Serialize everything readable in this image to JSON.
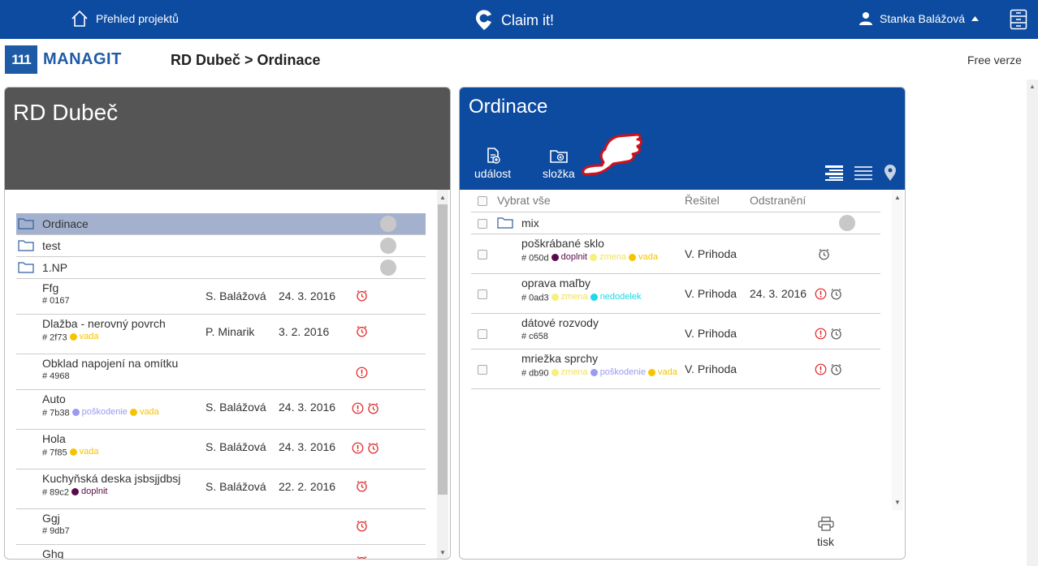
{
  "topbar": {
    "home_label": "Přehled projektů",
    "brand": "Claim it!",
    "user": "Stanka Balážová"
  },
  "header": {
    "logo_box": "111",
    "logo_text": "MANAGIT",
    "breadcrumb": "RD Dubeč > Ordinace",
    "free": "Free verze"
  },
  "left": {
    "title": "RD Dubeč",
    "folders": [
      {
        "name": "Ordinace",
        "selected": true
      },
      {
        "name": "test"
      },
      {
        "name": "1.NP"
      }
    ],
    "items": [
      {
        "title": "Ffg",
        "code": "# 0167",
        "tags": [],
        "person": "S. Balážová",
        "date": "24. 3. 2016",
        "warn": false,
        "clock": true
      },
      {
        "title": "Dlažba - nerovný povrch",
        "code": "# 2f73",
        "tags": [
          {
            "label": "vada",
            "color": "#f5c400"
          }
        ],
        "person": "P. Minarik",
        "date": "3. 2. 2016",
        "warn": false,
        "clock": true
      },
      {
        "title": "Obklad napojení na omítku",
        "code": "# 4968",
        "tags": [],
        "person": "",
        "date": "",
        "warn": true,
        "clock": false
      },
      {
        "title": "Auto",
        "code": "# 7b38",
        "tags": [
          {
            "label": "poškodenie",
            "color": "#9a9af2"
          },
          {
            "label": "vada",
            "color": "#f5c400"
          }
        ],
        "person": "S. Balážová",
        "date": "24. 3. 2016",
        "warn": true,
        "clock": true
      },
      {
        "title": "Hola",
        "code": "# 7f85",
        "tags": [
          {
            "label": "vada",
            "color": "#f5c400"
          }
        ],
        "person": "S. Balážová",
        "date": "24. 3. 2016",
        "warn": true,
        "clock": true
      },
      {
        "title": "Kuchyňská deska jsbsjjdbsj",
        "code": "# 89c2",
        "tags": [
          {
            "label": "doplnit",
            "color": "#5a0a4a"
          }
        ],
        "person": "S. Balážová",
        "date": "22. 2. 2016",
        "warn": false,
        "clock": true
      },
      {
        "title": "Ggj",
        "code": "# 9db7",
        "tags": [],
        "person": "",
        "date": "",
        "warn": false,
        "clock": true
      },
      {
        "title": "Ghg",
        "code": "",
        "tags": [],
        "person": "",
        "date": "",
        "warn": false,
        "clock": true
      }
    ]
  },
  "right": {
    "title": "Ordinace",
    "tool_event": "událost",
    "tool_folder": "složka",
    "col_select": "Vybrat vše",
    "col_solver": "Řešitel",
    "col_removal": "Odstranění",
    "folders": [
      {
        "name": "mix"
      }
    ],
    "items": [
      {
        "title": "poškrábané sklo",
        "code": "# 050d",
        "tags": [
          {
            "label": "doplnit",
            "color": "#5a0a4a"
          },
          {
            "label": "zmena",
            "color": "#f7f07a"
          },
          {
            "label": "vada",
            "color": "#f5c400"
          }
        ],
        "solver": "V. Prihoda",
        "date": "",
        "warn": false,
        "clock": true
      },
      {
        "title": "oprava maľby",
        "code": "# 0ad3",
        "tags": [
          {
            "label": "zmena",
            "color": "#f7f07a"
          },
          {
            "label": "nedodelek",
            "color": "#1ed8e8"
          }
        ],
        "solver": "V. Prihoda",
        "date": "24. 3. 2016",
        "warn": true,
        "clock": true
      },
      {
        "title": "dátové rozvody",
        "code": "# c658",
        "tags": [],
        "solver": "V. Prihoda",
        "date": "",
        "warn": true,
        "clock": true
      },
      {
        "title": "mriežka sprchy",
        "code": "# db90",
        "tags": [
          {
            "label": "zmena",
            "color": "#f7f07a"
          },
          {
            "label": "poškodenie",
            "color": "#9a9af2"
          },
          {
            "label": "vada",
            "color": "#f5c400"
          }
        ],
        "solver": "V. Prihoda",
        "date": "",
        "warn": true,
        "clock": true
      }
    ],
    "print": "tisk"
  }
}
